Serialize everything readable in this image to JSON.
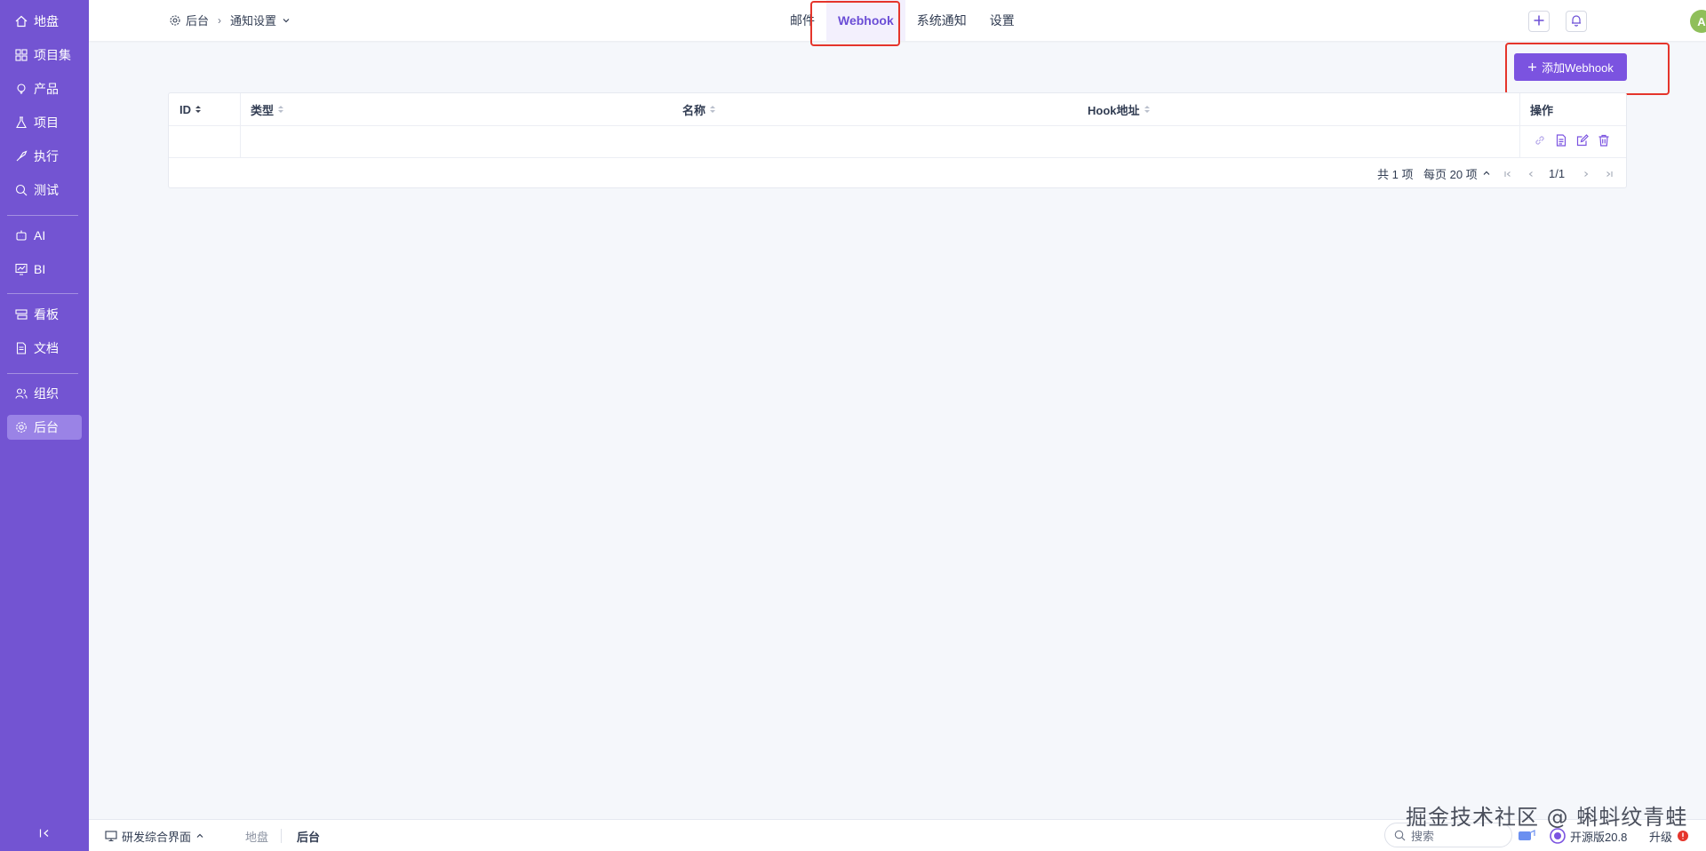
{
  "sidebar": {
    "items": [
      {
        "label": "地盘",
        "icon": "home-icon"
      },
      {
        "label": "项目集",
        "icon": "grid-icon"
      },
      {
        "label": "产品",
        "icon": "lightbulb-icon"
      },
      {
        "label": "项目",
        "icon": "flask-icon"
      },
      {
        "label": "执行",
        "icon": "rocket-icon"
      },
      {
        "label": "测试",
        "icon": "search-bug-icon"
      },
      {
        "label": "AI",
        "icon": "robot-icon"
      },
      {
        "label": "BI",
        "icon": "chart-icon"
      },
      {
        "label": "看板",
        "icon": "kanban-icon"
      },
      {
        "label": "文档",
        "icon": "document-icon"
      },
      {
        "label": "组织",
        "icon": "people-icon"
      },
      {
        "label": "后台",
        "icon": "gear-icon"
      }
    ],
    "active": "后台"
  },
  "header": {
    "breadcrumb": {
      "root": "后台",
      "current": "通知设置"
    },
    "tabs": [
      "邮件",
      "Webhook",
      "系统通知",
      "设置"
    ],
    "active_tab": "Webhook",
    "avatar_initial": "A"
  },
  "main": {
    "add_button": "添加Webhook",
    "table": {
      "columns": [
        "ID",
        "类型",
        "名称",
        "Hook地址",
        "操作"
      ]
    },
    "pager": {
      "total": "共 1 项",
      "per_page": "每页 20 项",
      "page": "1/1"
    }
  },
  "footer": {
    "app_switch": "研发综合界面",
    "tabs": [
      "地盘",
      "后台"
    ],
    "search_placeholder": "搜索",
    "version": "开源版20.8",
    "upgrade": "升级"
  },
  "watermark": "掘金技术社区 @ 蝌蚪纹青蛙",
  "colors": {
    "sidebar": "#7354d2",
    "accent": "#7b53e0",
    "highlight": "#e5352b"
  }
}
